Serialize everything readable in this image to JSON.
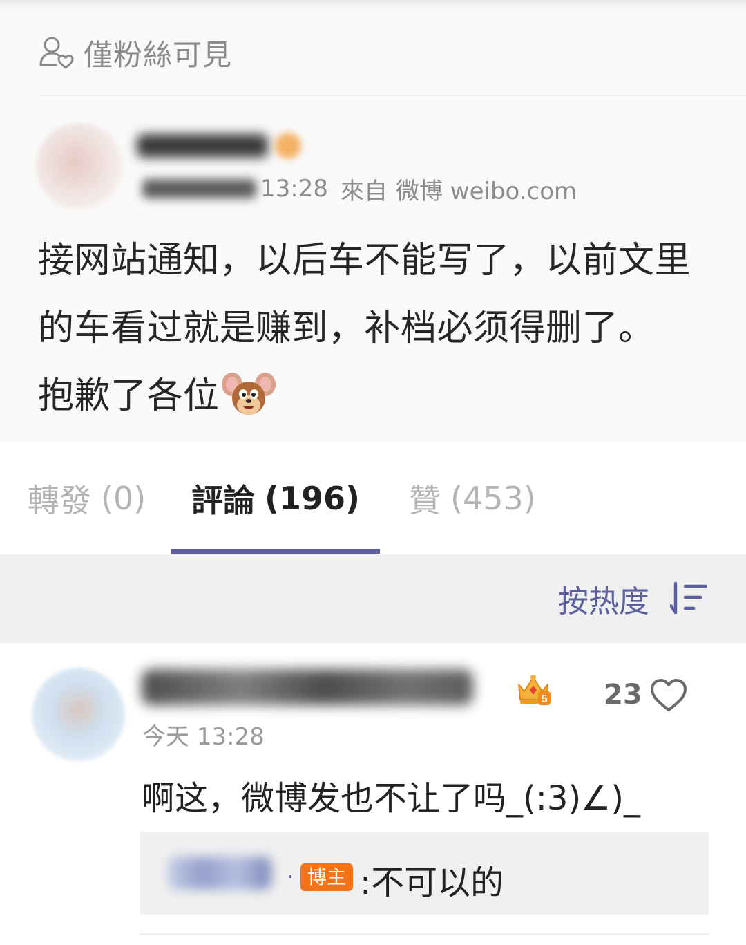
{
  "post": {
    "visibility": "僅粉絲可見",
    "time": "13:28",
    "from_label": "來自",
    "source": "微博 weibo.com",
    "text_lines": [
      "接网站通知，以后车不能写了，以前文里",
      "的车看过就是赚到，补档必须得删了。",
      "抱歉了各位"
    ],
    "emoji": "jerry-mouse-emoji"
  },
  "tabs": [
    {
      "label": "轉發",
      "count": "(0)",
      "active": false
    },
    {
      "label": "評論",
      "count": "(196)",
      "active": true
    },
    {
      "label": "贊",
      "count": "(453)",
      "active": false
    }
  ],
  "sort": {
    "label": "按热度",
    "icon": "sort-descending-icon"
  },
  "comment": {
    "time": "今天 13:28",
    "likes": "23",
    "text": "啊这，微博发也不让了吗_(:3)∠)_",
    "badge_icon": "crown-level-5-icon",
    "reply": {
      "dot": ".",
      "badge": "博主",
      "text": ":不可以的"
    }
  },
  "colors": {
    "accent": "#5b5f9e",
    "blogger_badge": "#f47318",
    "muted_text": "#8d8d8d",
    "card_bg": "#f9f9f9",
    "sort_bg": "#f0f0f1"
  }
}
